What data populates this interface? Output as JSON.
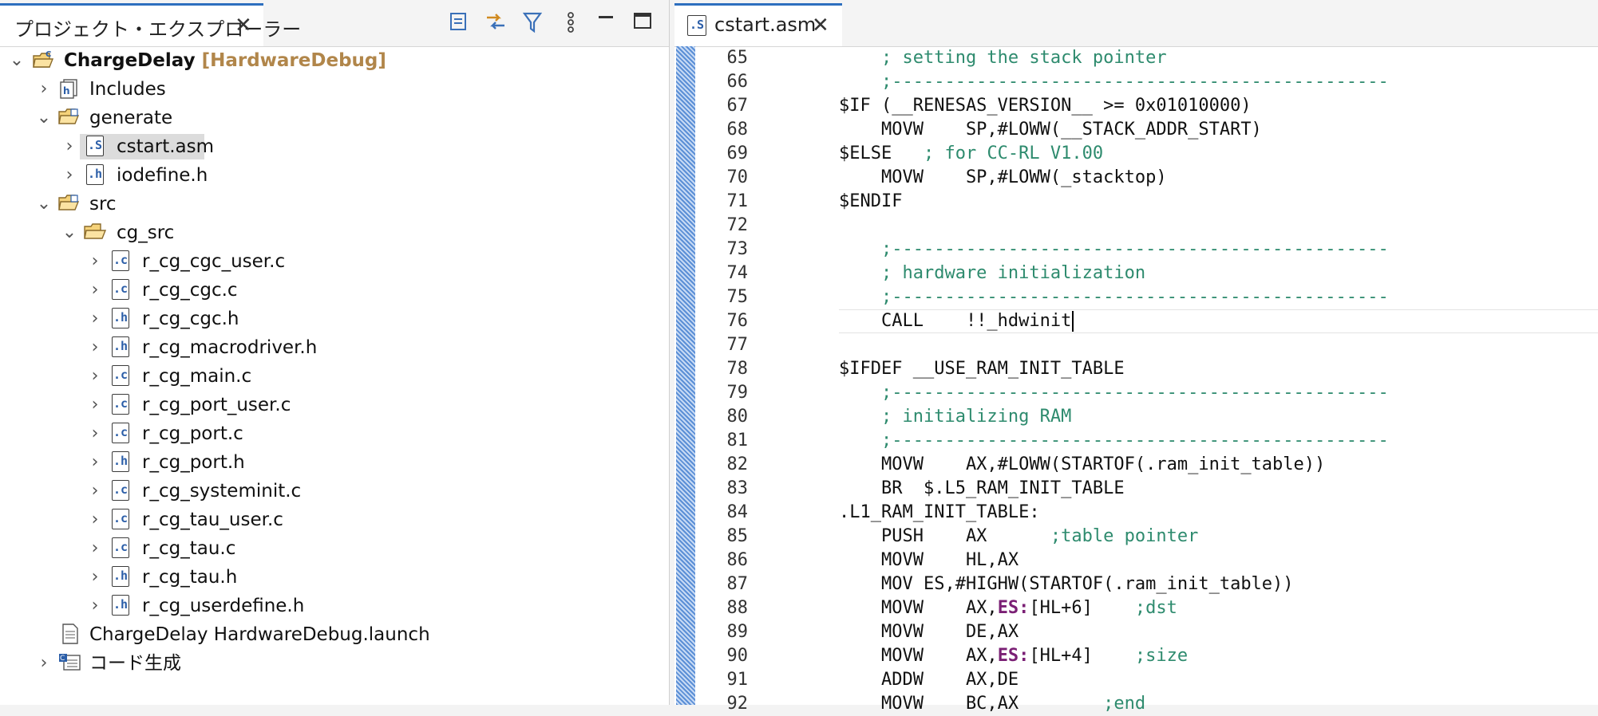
{
  "left_panel": {
    "tab_title": "プロジェクト・エクスプローラー",
    "toolbar": [
      "collapse-all-icon",
      "link-editor-icon",
      "filter-icon",
      "view-menu-icon",
      "minimize-icon",
      "maximize-icon"
    ],
    "tree": [
      {
        "label": "ChargeDelay",
        "badge": "[HardwareDebug]",
        "type": "project",
        "expanded": true,
        "depth": 0
      },
      {
        "label": "Includes",
        "type": "includes",
        "expanded": false,
        "depth": 1
      },
      {
        "label": "generate",
        "type": "folder",
        "expanded": true,
        "depth": 1
      },
      {
        "label": "cstart.asm",
        "type": "file-s",
        "expanded": false,
        "depth": 2,
        "selected": true
      },
      {
        "label": "iodefine.h",
        "type": "file-h",
        "expanded": false,
        "depth": 2
      },
      {
        "label": "src",
        "type": "folder",
        "expanded": true,
        "depth": 1
      },
      {
        "label": "cg_src",
        "type": "folder-open",
        "expanded": true,
        "depth": 2
      },
      {
        "label": "r_cg_cgc_user.c",
        "type": "file-c",
        "depth": 3
      },
      {
        "label": "r_cg_cgc.c",
        "type": "file-c",
        "depth": 3
      },
      {
        "label": "r_cg_cgc.h",
        "type": "file-h",
        "depth": 3
      },
      {
        "label": "r_cg_macrodriver.h",
        "type": "file-h",
        "depth": 3
      },
      {
        "label": "r_cg_main.c",
        "type": "file-c",
        "depth": 3
      },
      {
        "label": "r_cg_port_user.c",
        "type": "file-c",
        "depth": 3
      },
      {
        "label": "r_cg_port.c",
        "type": "file-c",
        "depth": 3
      },
      {
        "label": "r_cg_port.h",
        "type": "file-h",
        "depth": 3
      },
      {
        "label": "r_cg_systeminit.c",
        "type": "file-c",
        "depth": 3
      },
      {
        "label": "r_cg_tau_user.c",
        "type": "file-c",
        "depth": 3
      },
      {
        "label": "r_cg_tau.c",
        "type": "file-c",
        "depth": 3
      },
      {
        "label": "r_cg_tau.h",
        "type": "file-h",
        "depth": 3
      },
      {
        "label": "r_cg_userdefine.h",
        "type": "file-h",
        "depth": 3
      },
      {
        "label": "ChargeDelay HardwareDebug.launch",
        "type": "launch",
        "depth": 1
      },
      {
        "label": "コード生成",
        "type": "codegen",
        "expanded": false,
        "depth": 0
      }
    ]
  },
  "editor": {
    "tab_title": "cstart.asm",
    "lines": [
      {
        "n": "65",
        "code": "    ; setting the stack pointer",
        "style": "comment"
      },
      {
        "n": "66",
        "code": "    ;-----------------------------------------------",
        "style": "comment"
      },
      {
        "n": "67",
        "code": "$IF (__RENESAS_VERSION__ >= 0x01010000)",
        "style": "plain"
      },
      {
        "n": "68",
        "code": "    MOVW    SP,#LOWW(__STACK_ADDR_START)",
        "style": "plain"
      },
      {
        "n": "69",
        "code": "$ELSE",
        "comment": "   ; for CC-RL V1.00",
        "style": "mixed"
      },
      {
        "n": "70",
        "code": "    MOVW    SP,#LOWW(_stacktop)",
        "style": "plain"
      },
      {
        "n": "71",
        "code": "$ENDIF",
        "style": "plain"
      },
      {
        "n": "72",
        "code": "",
        "style": "plain"
      },
      {
        "n": "73",
        "code": "    ;-----------------------------------------------",
        "style": "comment"
      },
      {
        "n": "74",
        "code": "    ; hardware initialization",
        "style": "comment"
      },
      {
        "n": "75",
        "code": "    ;-----------------------------------------------",
        "style": "comment"
      },
      {
        "n": "76",
        "code": "    CALL    !!_hdwinit",
        "style": "current"
      },
      {
        "n": "77",
        "code": "",
        "style": "plain"
      },
      {
        "n": "78",
        "code": "$IFDEF __USE_RAM_INIT_TABLE",
        "style": "plain"
      },
      {
        "n": "79",
        "code": "    ;-----------------------------------------------",
        "style": "comment"
      },
      {
        "n": "80",
        "code": "    ; initializing RAM",
        "style": "comment"
      },
      {
        "n": "81",
        "code": "    ;-----------------------------------------------",
        "style": "comment"
      },
      {
        "n": "82",
        "code": "    MOVW    AX,#LOWW(STARTOF(.ram_init_table))",
        "style": "plain"
      },
      {
        "n": "83",
        "code": "    BR  $.L5_RAM_INIT_TABLE",
        "style": "plain"
      },
      {
        "n": "84",
        "code": ".L1_RAM_INIT_TABLE:",
        "style": "plain"
      },
      {
        "n": "85",
        "code": "    PUSH    AX",
        "comment": "      ;table pointer",
        "style": "mixed"
      },
      {
        "n": "86",
        "code": "    MOVW    HL,AX",
        "style": "plain"
      },
      {
        "n": "87",
        "code": "    MOV ES,#HIGHW(STARTOF(.ram_init_table))",
        "style": "plain"
      },
      {
        "n": "88",
        "pre": "    MOVW    AX,",
        "kw": "ES:",
        "post": "[HL+6]",
        "comment": "    ;dst",
        "style": "kwline"
      },
      {
        "n": "89",
        "code": "    MOVW    DE,AX",
        "style": "plain"
      },
      {
        "n": "90",
        "pre": "    MOVW    AX,",
        "kw": "ES:",
        "post": "[HL+4]",
        "comment": "    ;size",
        "style": "kwline"
      },
      {
        "n": "91",
        "code": "    ADDW    AX,DE",
        "style": "plain"
      },
      {
        "n": "92",
        "code": "    MOVW    BC,AX",
        "comment": "        ;end",
        "style": "mixed"
      }
    ]
  },
  "colors": {
    "accent": "#2d6fbf",
    "comment": "#2e8b6e",
    "keyword": "#7a1f74",
    "badge": "#b1864a"
  }
}
